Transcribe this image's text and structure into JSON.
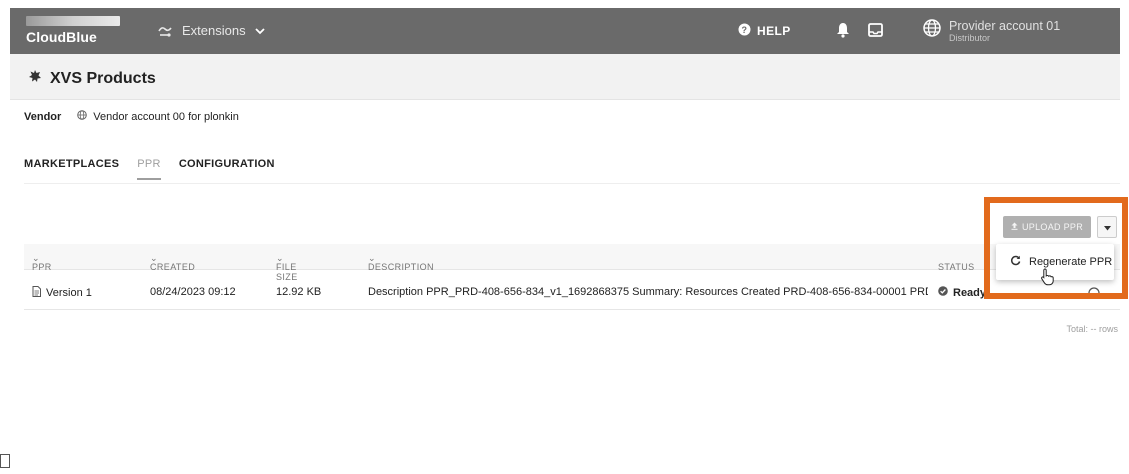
{
  "header": {
    "logo": "CloudBlue",
    "extensions_label": "Extensions",
    "help_label": "HELP",
    "account_name": "Provider account 01",
    "account_role": "Distributor"
  },
  "page": {
    "title": "XVS Products",
    "vendor_label": "Vendor",
    "vendor_value": "Vendor account 00 for plonkin"
  },
  "tabs": [
    {
      "label": "MARKETPLACES",
      "active": false
    },
    {
      "label": "PPR",
      "active": true
    },
    {
      "label": "CONFIGURATION",
      "active": false
    }
  ],
  "actions": {
    "upload_label": "UPLOAD PPR",
    "menu_item": "Regenerate PPR"
  },
  "table": {
    "headers": {
      "ppr": "PPR",
      "created": "CREATED",
      "file_size": "FILE SIZE",
      "description": "DESCRIPTION",
      "status": "STATUS"
    },
    "rows": [
      {
        "ppr": "Version 1",
        "created": "08/24/2023 09:12",
        "file_size": "12.92 KB",
        "description": "Description PPR_PRD-408-656-834_v1_1692868375 Summary: Resources Created PRD-408-656-834-00001 PRD-408...",
        "status": "Ready"
      }
    ],
    "total": "Total: -- rows"
  },
  "colors": {
    "topbar": "#6a6a6a",
    "highlight": "#e26a1c"
  }
}
